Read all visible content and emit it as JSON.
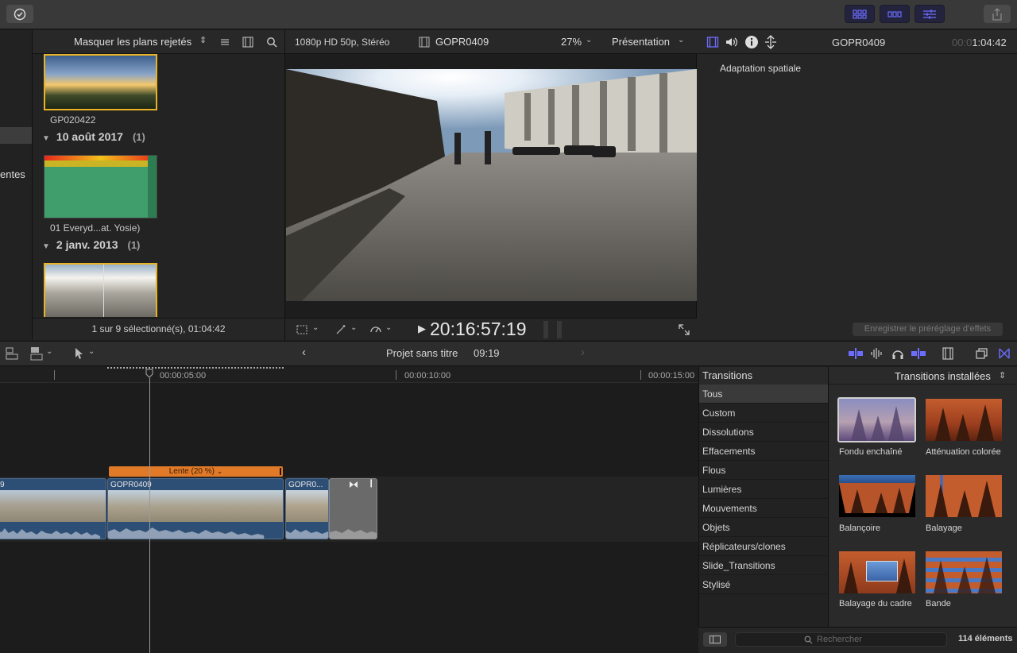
{
  "browser": {
    "filter_label": "Masquer les plans rejetés",
    "sidebar_label": "entes",
    "clip1_name": "GP020422",
    "group1_date": "10 août 2017",
    "group1_count": "(1)",
    "clip2_name": "01 Everyd...at. Yosie)",
    "group2_date": "2 janv. 2013",
    "group2_count": "(1)",
    "footer": "1 sur 9 sélectionné(s), 01:04:42"
  },
  "viewer": {
    "format": "1080p HD 50p, Stéréo",
    "clip_name": "GOPR0409",
    "zoom": "27%",
    "presentation": "Présentation",
    "timecode": "20:16:57:19"
  },
  "inspector": {
    "clip_name": "GOPR0409",
    "duration_dim": "00:0",
    "duration": "1:04:42",
    "param": "Adaptation spatiale",
    "save_preset": "Enregistrer le préréglage d’effets"
  },
  "timeline": {
    "project_name": "Projet sans titre",
    "project_duration": "09:19",
    "ruler_labels": [
      "00:00:05:00",
      "00:00:10:00",
      "00:00:15:00"
    ],
    "speed_label": "Lente (20 %)",
    "clip_left_label": "9",
    "clip_mid_label": "GOPR0409",
    "clip_right_label": "GOPR0..."
  },
  "transitions": {
    "title": "Transitions",
    "installed": "Transitions installées",
    "categories": [
      "Tous",
      "Custom",
      "Dissolutions",
      "Effacements",
      "Flous",
      "Lumières",
      "Mouvements",
      "Objets",
      "Réplicateurs/clones",
      "Slide_Transitions",
      "Stylisé"
    ],
    "items": [
      "Fondu enchaîné",
      "Atténuation colorée",
      "Balançoire",
      "Balayage",
      "Balayage du cadre",
      "Bande"
    ],
    "search_placeholder": "Rechercher",
    "count": "114 éléments"
  },
  "colors": {
    "accent_blue": "#5b5bff",
    "selection_yellow": "#e8b326",
    "speed_orange": "#e07a28",
    "clip_blue": "#2e4f75"
  }
}
